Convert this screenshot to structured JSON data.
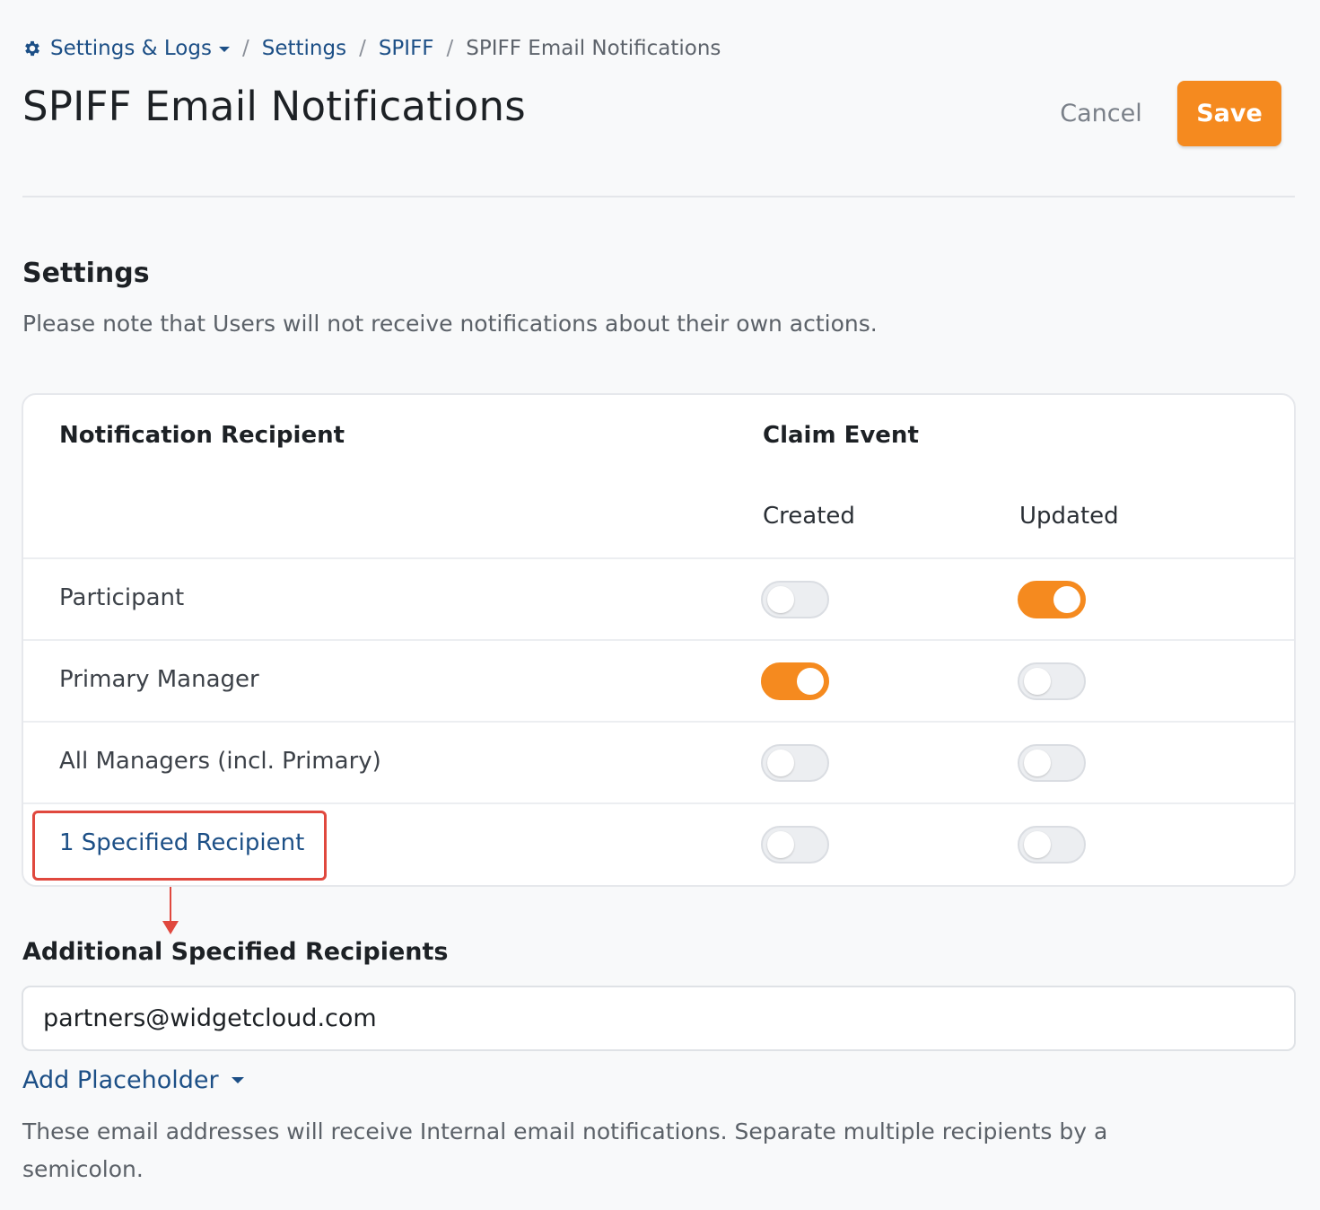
{
  "breadcrumb": {
    "root": "Settings & Logs",
    "items": [
      "Settings",
      "SPIFF"
    ],
    "current": "SPIFF Email Notifications"
  },
  "header": {
    "title": "SPIFF Email Notifications",
    "cancel_label": "Cancel",
    "save_label": "Save"
  },
  "settings": {
    "title": "Settings",
    "note": "Please note that Users will not receive notifications about their own actions."
  },
  "table": {
    "recipient_header": "Notification Recipient",
    "event_header": "Claim Event",
    "columns": [
      "Created",
      "Updated"
    ],
    "rows": [
      {
        "label": "Participant",
        "created": false,
        "updated": true
      },
      {
        "label": "Primary Manager",
        "created": true,
        "updated": false
      },
      {
        "label": "All Managers (incl. Primary)",
        "created": false,
        "updated": false
      },
      {
        "label": "1 Specified Recipient",
        "created": false,
        "updated": false
      }
    ]
  },
  "additional": {
    "title": "Additional Specified Recipients",
    "value": "partners@widgetcloud.com",
    "placeholder_button": "Add Placeholder",
    "help": "These email addresses will receive Internal email notifications. Separate multiple recipients by a semicolon."
  },
  "colors": {
    "accent": "#f58a1f",
    "link": "#1c4f86",
    "annotation": "#e0483e"
  },
  "icons": {
    "breadcrumb_root": "gear-icon",
    "dropdown": "caret-down-icon"
  }
}
